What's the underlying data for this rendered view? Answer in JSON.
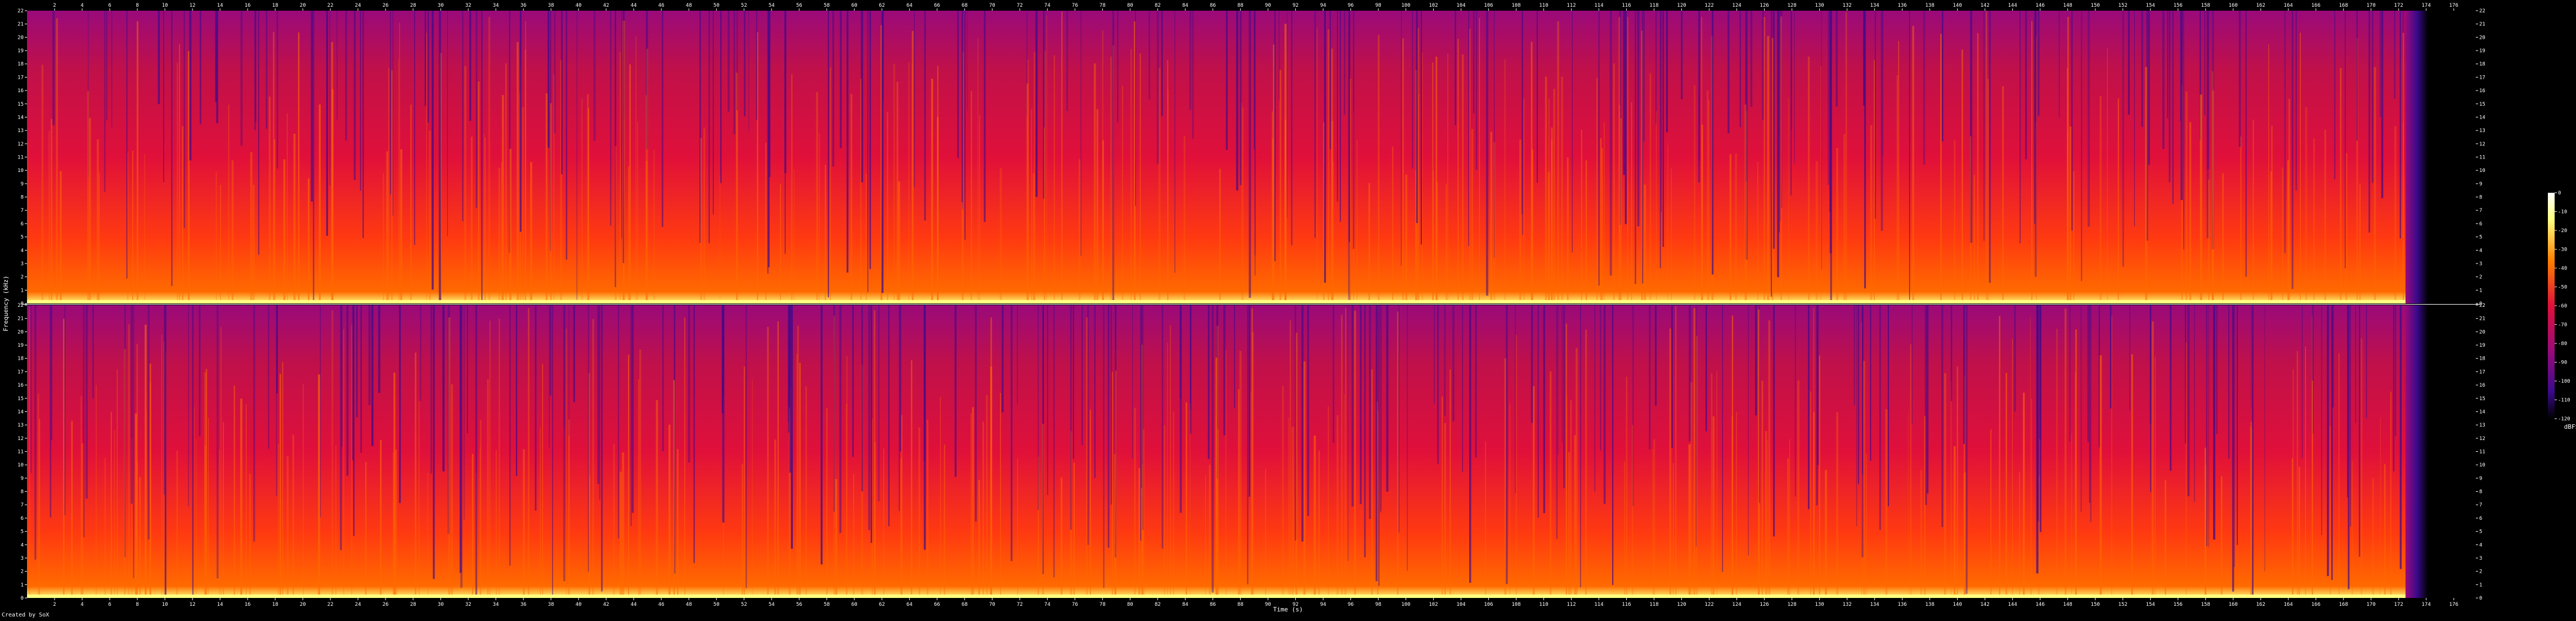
{
  "credit": "Created by SoX",
  "chart_data": {
    "type": "heatmap",
    "title": "",
    "xlabel": "Time (s)",
    "ylabel": "Frequency (kHz)",
    "colorbar_label": "dBFS",
    "colorbar_ticks": [
      0,
      -10,
      -20,
      -30,
      -40,
      -50,
      -60,
      -70,
      -80,
      -90,
      -100,
      -110,
      -120
    ],
    "xlim": [
      0,
      177.6
    ],
    "x_ticks": [
      2,
      4,
      6,
      8,
      10,
      12,
      14,
      16,
      18,
      20,
      22,
      24,
      26,
      28,
      30,
      32,
      34,
      36,
      38,
      40,
      42,
      44,
      46,
      48,
      50,
      52,
      54,
      56,
      58,
      60,
      62,
      64,
      66,
      68,
      70,
      72,
      74,
      76,
      78,
      80,
      82,
      84,
      86,
      88,
      90,
      92,
      94,
      96,
      98,
      100,
      102,
      104,
      106,
      108,
      110,
      112,
      114,
      116,
      118,
      120,
      122,
      124,
      126,
      128,
      130,
      132,
      134,
      136,
      138,
      140,
      142,
      144,
      146,
      148,
      150,
      152,
      154,
      156,
      158,
      160,
      162,
      164,
      166,
      168,
      170,
      172,
      174,
      176
    ],
    "y_ticks_khz": [
      0,
      1,
      2,
      3,
      4,
      5,
      6,
      7,
      8,
      9,
      10,
      11,
      12,
      13,
      14,
      15,
      16,
      17,
      18,
      19,
      20,
      21,
      22
    ],
    "ylim": [
      0,
      22
    ],
    "audio_end_seconds": 172.5,
    "channels": [
      {
        "name": "",
        "panel": "top"
      },
      {
        "name": "",
        "panel": "bottom"
      }
    ],
    "colors": {
      "background": "#000000",
      "hot": "#ffff80",
      "warm": "#ff6a00",
      "mid": "#e0103a",
      "low": "#9a0a7a",
      "cold": "#3a0a8c",
      "silence": "#000000"
    }
  }
}
